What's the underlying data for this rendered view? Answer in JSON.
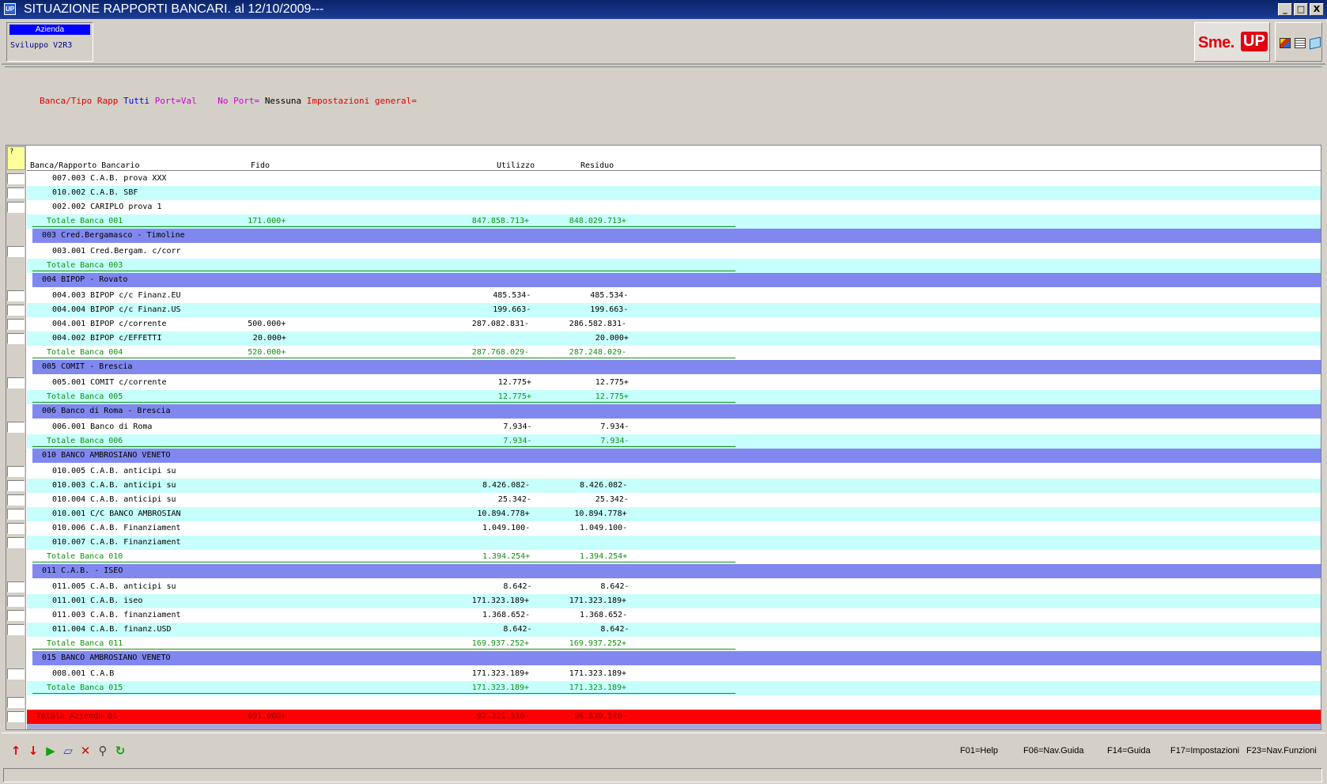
{
  "window": {
    "app_icon": "UP",
    "title": "SITUAZIONE RAPPORTI BANCARI.  al 12/10/2009---",
    "controls": [
      "_",
      "□",
      "X"
    ]
  },
  "header": {
    "azienda_label": "Azienda",
    "azienda_value": "Sviluppo V2R3",
    "logo_text": "Sme.",
    "logo_badge": "UP",
    "tool_icons": [
      "palette-icon",
      "list-icon",
      "book-icon"
    ]
  },
  "filter": {
    "banca_label": "Banca/Tipo Rapp",
    "banca_value": "Tutti",
    "port_label": "Port=Val",
    "noport_label": "No Port=",
    "noport_value": "Nessuna",
    "impostazioni_label": "Impostazioni general="
  },
  "grid": {
    "corner": "?",
    "columns": {
      "banca": "Banca/Rapporto Bancario",
      "fido": "Fido",
      "utilizzo": "Utilizzo",
      "residuo": "Residuo"
    },
    "rows": [
      {
        "kind": "item",
        "bg": "white",
        "label": "007.003 C.A.B. prova XXX",
        "fido": "",
        "utilizzo": "",
        "residuo": ""
      },
      {
        "kind": "item",
        "bg": "cyan",
        "label": "010.002 C.A.B. SBF",
        "fido": "",
        "utilizzo": "",
        "residuo": ""
      },
      {
        "kind": "item",
        "bg": "white",
        "label": "002.002 CARIPLO prova 1",
        "fido": "",
        "utilizzo": "",
        "residuo": ""
      },
      {
        "kind": "total",
        "bg": "cyan",
        "label": "Totale Banca 001",
        "fido": "171.000+",
        "utilizzo": "847.858.713+",
        "residuo": "848.029.713+"
      },
      {
        "kind": "bank",
        "label": "003 Cred.Bergamasco - Timoline"
      },
      {
        "kind": "item",
        "bg": "white",
        "label": "003.001 Cred.Bergam. c/corr",
        "fido": "",
        "utilizzo": "",
        "residuo": ""
      },
      {
        "kind": "total",
        "bg": "cyan",
        "label": "Totale Banca 003",
        "fido": "",
        "utilizzo": "",
        "residuo": ""
      },
      {
        "kind": "bank",
        "label": "004 BIPOP - Rovato"
      },
      {
        "kind": "item",
        "bg": "white",
        "label": "004.003 BIPOP c/c Finanz.EU",
        "fido": "",
        "utilizzo": "485.534-",
        "residuo": "485.534-"
      },
      {
        "kind": "item",
        "bg": "cyan",
        "label": "004.004 BIPOP c/c Finanz.US",
        "fido": "",
        "utilizzo": "199.663-",
        "residuo": "199.663-"
      },
      {
        "kind": "item",
        "bg": "white",
        "label": "004.001 BIPOP c/corrente",
        "fido": "500.000+",
        "utilizzo": "287.082.831-",
        "residuo": "286.582.831-"
      },
      {
        "kind": "item",
        "bg": "cyan",
        "label": "004.002 BIPOP c/EFFETTI",
        "fido": "20.000+",
        "utilizzo": "",
        "residuo": "20.000+"
      },
      {
        "kind": "total",
        "bg": "white",
        "label": "Totale Banca 004",
        "fido": "520.000+",
        "utilizzo": "287.768.029-",
        "residuo": "287.248.029-"
      },
      {
        "kind": "bank",
        "label": "005 COMIT - Brescia"
      },
      {
        "kind": "item",
        "bg": "white",
        "label": "005.001 COMIT c/corrente",
        "fido": "",
        "utilizzo": "12.775+",
        "residuo": "12.775+"
      },
      {
        "kind": "total",
        "bg": "cyan",
        "label": "Totale Banca 005",
        "fido": "",
        "utilizzo": "12.775+",
        "residuo": "12.775+"
      },
      {
        "kind": "bank",
        "label": "006 Banco di Roma - Brescia"
      },
      {
        "kind": "item",
        "bg": "white",
        "label": "006.001 Banco di Roma",
        "fido": "",
        "utilizzo": "7.934-",
        "residuo": "7.934-"
      },
      {
        "kind": "total",
        "bg": "cyan",
        "label": "Totale Banca 006",
        "fido": "",
        "utilizzo": "7.934-",
        "residuo": "7.934-"
      },
      {
        "kind": "bank",
        "label": "010 BANCO AMBROSIANO VENETO"
      },
      {
        "kind": "item",
        "bg": "white",
        "label": "010.005 C.A.B. anticipi su",
        "fido": "",
        "utilizzo": "",
        "residuo": ""
      },
      {
        "kind": "item",
        "bg": "cyan",
        "label": "010.003 C.A.B. anticipi su",
        "fido": "",
        "utilizzo": "8.426.082-",
        "residuo": "8.426.082-"
      },
      {
        "kind": "item",
        "bg": "white",
        "label": "010.004 C.A.B. anticipi su",
        "fido": "",
        "utilizzo": "25.342-",
        "residuo": "25.342-"
      },
      {
        "kind": "item",
        "bg": "cyan",
        "label": "010.001 C/C BANCO AMBROSIAN",
        "fido": "",
        "utilizzo": "10.894.778+",
        "residuo": "10.894.778+"
      },
      {
        "kind": "item",
        "bg": "white",
        "label": "010.006 C.A.B. Finanziament",
        "fido": "",
        "utilizzo": "1.049.100-",
        "residuo": "1.049.100-"
      },
      {
        "kind": "item",
        "bg": "cyan",
        "label": "010.007 C.A.B. Finanziament",
        "fido": "",
        "utilizzo": "",
        "residuo": ""
      },
      {
        "kind": "total",
        "bg": "white",
        "label": "Totale Banca 010",
        "fido": "",
        "utilizzo": "1.394.254+",
        "residuo": "1.394.254+"
      },
      {
        "kind": "bank",
        "label": "011 C.A.B. - ISEO"
      },
      {
        "kind": "item",
        "bg": "white",
        "label": "011.005 C.A.B. anticipi su",
        "fido": "",
        "utilizzo": "8.642-",
        "residuo": "8.642-"
      },
      {
        "kind": "item",
        "bg": "cyan",
        "label": "011.001 C.A.B. iseo",
        "fido": "",
        "utilizzo": "171.323.189+",
        "residuo": "171.323.189+"
      },
      {
        "kind": "item",
        "bg": "white",
        "label": "011.003 C.A.B. finanziament",
        "fido": "",
        "utilizzo": "1.368.652-",
        "residuo": "1.368.652-"
      },
      {
        "kind": "item",
        "bg": "cyan",
        "label": "011.004 C.A.B. finanz.USD",
        "fido": "",
        "utilizzo": "8.642-",
        "residuo": "8.642-"
      },
      {
        "kind": "total",
        "bg": "white",
        "label": "Totale Banca 011",
        "fido": "",
        "utilizzo": "169.937.252+",
        "residuo": "169.937.252+"
      },
      {
        "kind": "bank",
        "label": "015 BANCO AMBROSIANO VENETO"
      },
      {
        "kind": "item",
        "bg": "white",
        "label": "008.001 C.A.B",
        "fido": "",
        "utilizzo": "171.323.189+",
        "residuo": "171.323.189+"
      },
      {
        "kind": "total",
        "bg": "cyan",
        "label": "Totale Banca 015",
        "fido": "",
        "utilizzo": "171.323.189+",
        "residuo": "171.323.189+"
      },
      {
        "kind": "blank"
      },
      {
        "kind": "grand",
        "label": "Totale Azienda 01",
        "fido": "691.000+",
        "utilizzo": "97.221.510-",
        "residuo": "96.530.510-"
      },
      {
        "kind": "lav"
      }
    ]
  },
  "colors": {
    "bank_row": "#8088ef",
    "cyan_row": "#c6fffc",
    "total_text": "#109010",
    "grand_total": "#ff0000"
  },
  "toolbar": {
    "icons": [
      {
        "name": "arrow-up-icon",
        "glyph": "↑",
        "color": "#e00000"
      },
      {
        "name": "arrow-down-icon",
        "glyph": "↓",
        "color": "#e00000"
      },
      {
        "name": "play-icon",
        "glyph": "▶",
        "color": "#10a010"
      },
      {
        "name": "eraser-icon",
        "glyph": "▱",
        "color": "#2040c0"
      },
      {
        "name": "close-icon",
        "glyph": "✕",
        "color": "#e00000"
      },
      {
        "name": "search-icon",
        "glyph": "⚲",
        "color": "#404040"
      },
      {
        "name": "refresh-icon",
        "glyph": "↻",
        "color": "#10a010"
      }
    ],
    "function_keys": [
      "F01=Help",
      "F06=Nav.Guida",
      "F14=Guida",
      "F17=Impostazioni",
      "F23=Nav.Funzioni"
    ]
  }
}
